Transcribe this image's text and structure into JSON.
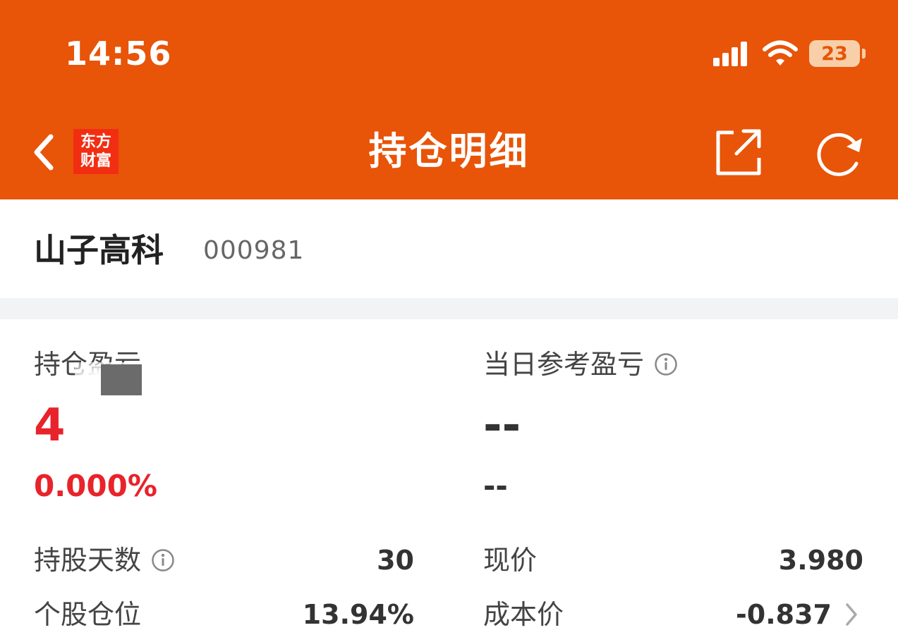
{
  "status_bar": {
    "time": "14:56",
    "battery_level": "23",
    "icons": [
      "cellular-signal-icon",
      "wifi-icon",
      "battery-icon"
    ]
  },
  "nav": {
    "title": "持仓明细",
    "logo_line1": "东方",
    "logo_line2": "财富",
    "icons": [
      "back-icon",
      "share-icon",
      "refresh-icon"
    ]
  },
  "stock": {
    "name": "山子高科",
    "code": "000981"
  },
  "position": {
    "holding_pl_label": "持仓盈亏",
    "holding_pl_value": "4",
    "holding_pl_pct": "0.000%",
    "daily_pl_label": "当日参考盈亏",
    "daily_pl_value": "--",
    "daily_pl_pct": "--"
  },
  "details": {
    "days_label": "持股天数",
    "days_value": "30",
    "price_label": "现价",
    "price_value": "3.980",
    "weight_label": "个股仓位",
    "weight_value": "13.94%",
    "cost_label": "成本价",
    "cost_value": "-0.837"
  },
  "colors": {
    "header_bg": "#e85408",
    "logo_bg": "#f22e12",
    "profit_red": "#e8232b",
    "divider": "#f2f3f5"
  }
}
